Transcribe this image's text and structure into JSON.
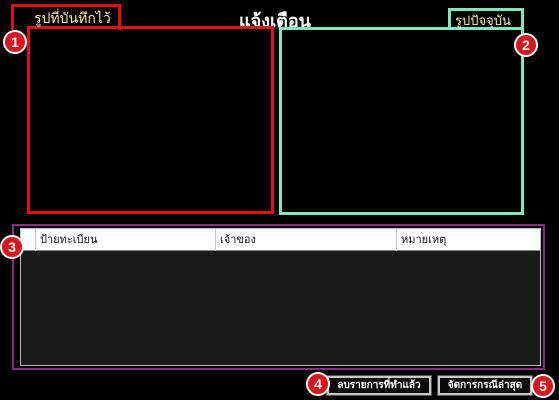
{
  "window": {
    "title": "แจ้งเตือน"
  },
  "panels": {
    "recorded": {
      "label": "รูปที่บันทึกไว้",
      "color": "#e01010"
    },
    "current": {
      "label": "รูปปัจจุบัน",
      "color": "#7fe8c0"
    }
  },
  "table": {
    "columns": [
      "ป้ายทะเบียน",
      "เจ้าของ",
      "หมายเหตุ"
    ],
    "rows": []
  },
  "buttons": {
    "clear_done": "ลบรายการที่ทำแล้ว",
    "latest_case": "จัดการกรณีล่าสุด"
  },
  "badges": [
    "1",
    "2",
    "3",
    "4",
    "5"
  ]
}
